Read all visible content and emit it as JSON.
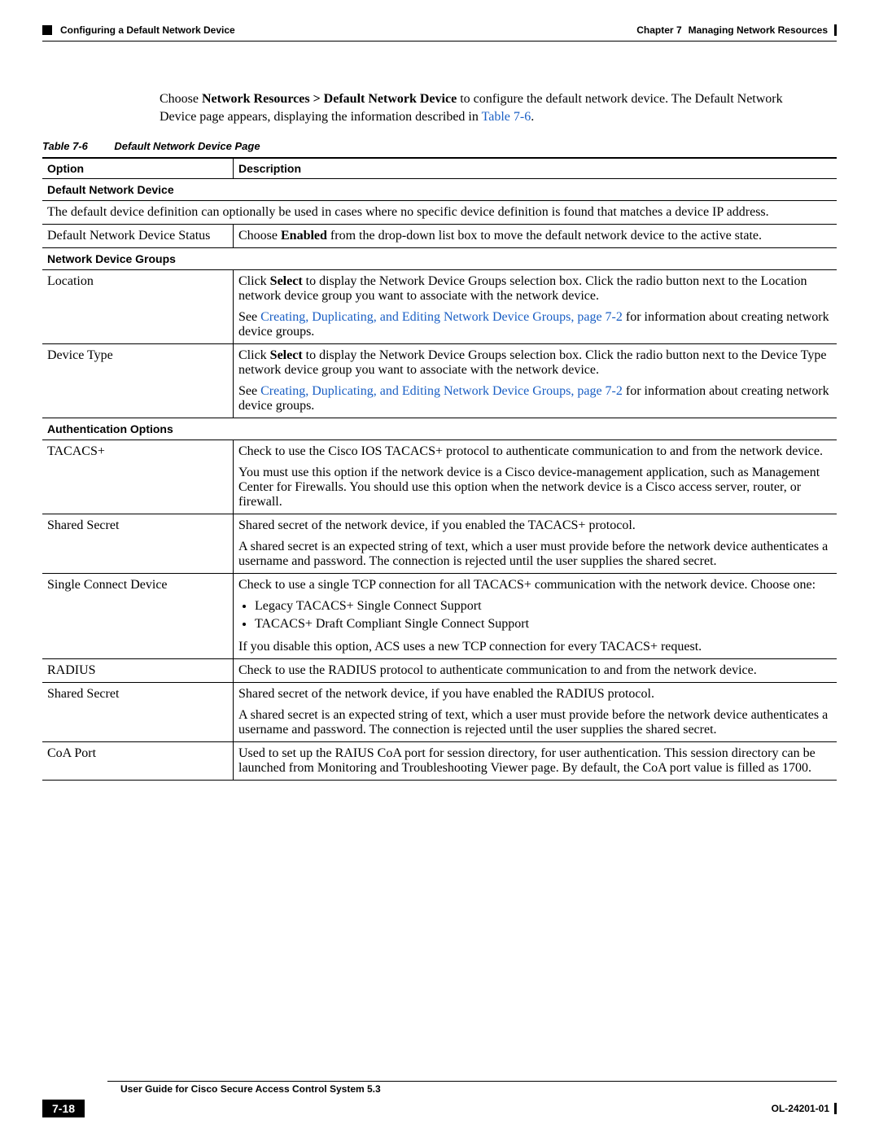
{
  "header": {
    "chapter": "Chapter 7",
    "chapter_title": "Managing Network Resources",
    "section": "Configuring a Default Network Device"
  },
  "intro": {
    "pre": "Choose ",
    "nav": "Network Resources > Default Network Device",
    "post1": " to configure the default network device. The Default Network Device page appears, displaying the information described in ",
    "link": "Table 7-6",
    "post2": "."
  },
  "table": {
    "caption_num": "Table 7-6",
    "caption_title": "Default Network Device Page",
    "col1": "Option",
    "col2": "Description",
    "s1_title": "Default Network Device",
    "s1_desc": "The default device definition can optionally be used in cases where no specific device definition is found that matches a device IP address.",
    "r1_opt": "Default Network Device Status",
    "r1_pre": "Choose ",
    "r1_bold": "Enabled",
    "r1_post": " from the drop-down list box to move the default network device to the active state.",
    "s2_title": "Network Device Groups",
    "loc_opt": "Location",
    "loc_p1a": "Click ",
    "loc_p1b": "Select",
    "loc_p1c": " to display the Network Device Groups selection box. Click the radio button next to the Location network device group you want to associate with the network device.",
    "loc_p2a": "See ",
    "loc_link": "Creating, Duplicating, and Editing Network Device Groups, page 7-2",
    "loc_p2b": " for information about creating network device groups.",
    "dev_opt": "Device Type",
    "dev_p1a": "Click ",
    "dev_p1b": "Select",
    "dev_p1c": " to display the Network Device Groups selection box. Click the radio button next to the Device Type network device group you want to associate with the network device.",
    "dev_p2a": "See ",
    "dev_link": "Creating, Duplicating, and Editing Network Device Groups, page 7-2",
    "dev_p2b": " for information about creating network device groups.",
    "s3_title": "Authentication Options",
    "tac_opt": "TACACS+",
    "tac_p1": "Check to use the Cisco IOS TACACS+ protocol to authenticate communication to and from the network device.",
    "tac_p2": "You must use this option if the network device is a Cisco device-management application, such as Management Center for Firewalls. You should use this option when the network device is a Cisco access server, router, or firewall.",
    "ss1_opt": "Shared Secret",
    "ss1_p1": "Shared secret of the network device, if you enabled the TACACS+ protocol.",
    "ss1_p2": "A shared secret is an expected string of text, which a user must provide before the network device authenticates a username and password. The connection is rejected until the user supplies the shared secret.",
    "sgl_opt": "Single Connect Device",
    "sgl_p1": "Check to use a single TCP connection for all TACACS+ communication with the network device. Choose one:",
    "sgl_b1": "Legacy TACACS+ Single Connect Support",
    "sgl_b2": "TACACS+ Draft Compliant Single Connect Support",
    "sgl_p2": "If you disable this option, ACS uses a new TCP connection for every TACACS+ request.",
    "rad_opt": "RADIUS",
    "rad_p1": "Check to use the RADIUS protocol to authenticate communication to and from the network device.",
    "ss2_opt": "Shared Secret",
    "ss2_p1": "Shared secret of the network device, if you have enabled the RADIUS protocol.",
    "ss2_p2": "A shared secret is an expected string of text, which a user must provide before the network device authenticates a username and password. The connection is rejected until the user supplies the shared secret.",
    "coa_opt": "CoA Port",
    "coa_p1": "Used to set up the RAIUS CoA port for session directory, for user authentication. This session directory can be launched from Monitoring and Troubleshooting Viewer page. By default, the CoA port value is filled as 1700."
  },
  "footer": {
    "guide": "User Guide for Cisco Secure Access Control System 5.3",
    "page": "7-18",
    "docid": "OL-24201-01"
  }
}
